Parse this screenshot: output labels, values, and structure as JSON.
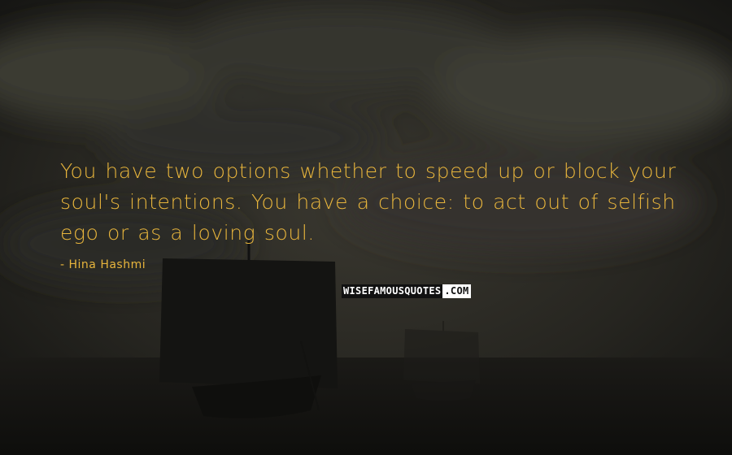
{
  "quote": {
    "text": "You have two options whether to speed up or block your soul's intentions. You have a choice: to act out of selfish ego or as a loving soul.",
    "author": "- Hina Hashmi"
  },
  "watermark": {
    "part1": "WISEFAMOUSQUOTES",
    "part2": ".COM"
  },
  "colors": {
    "text": "#e8b53c",
    "background": "#1e1d1a"
  }
}
